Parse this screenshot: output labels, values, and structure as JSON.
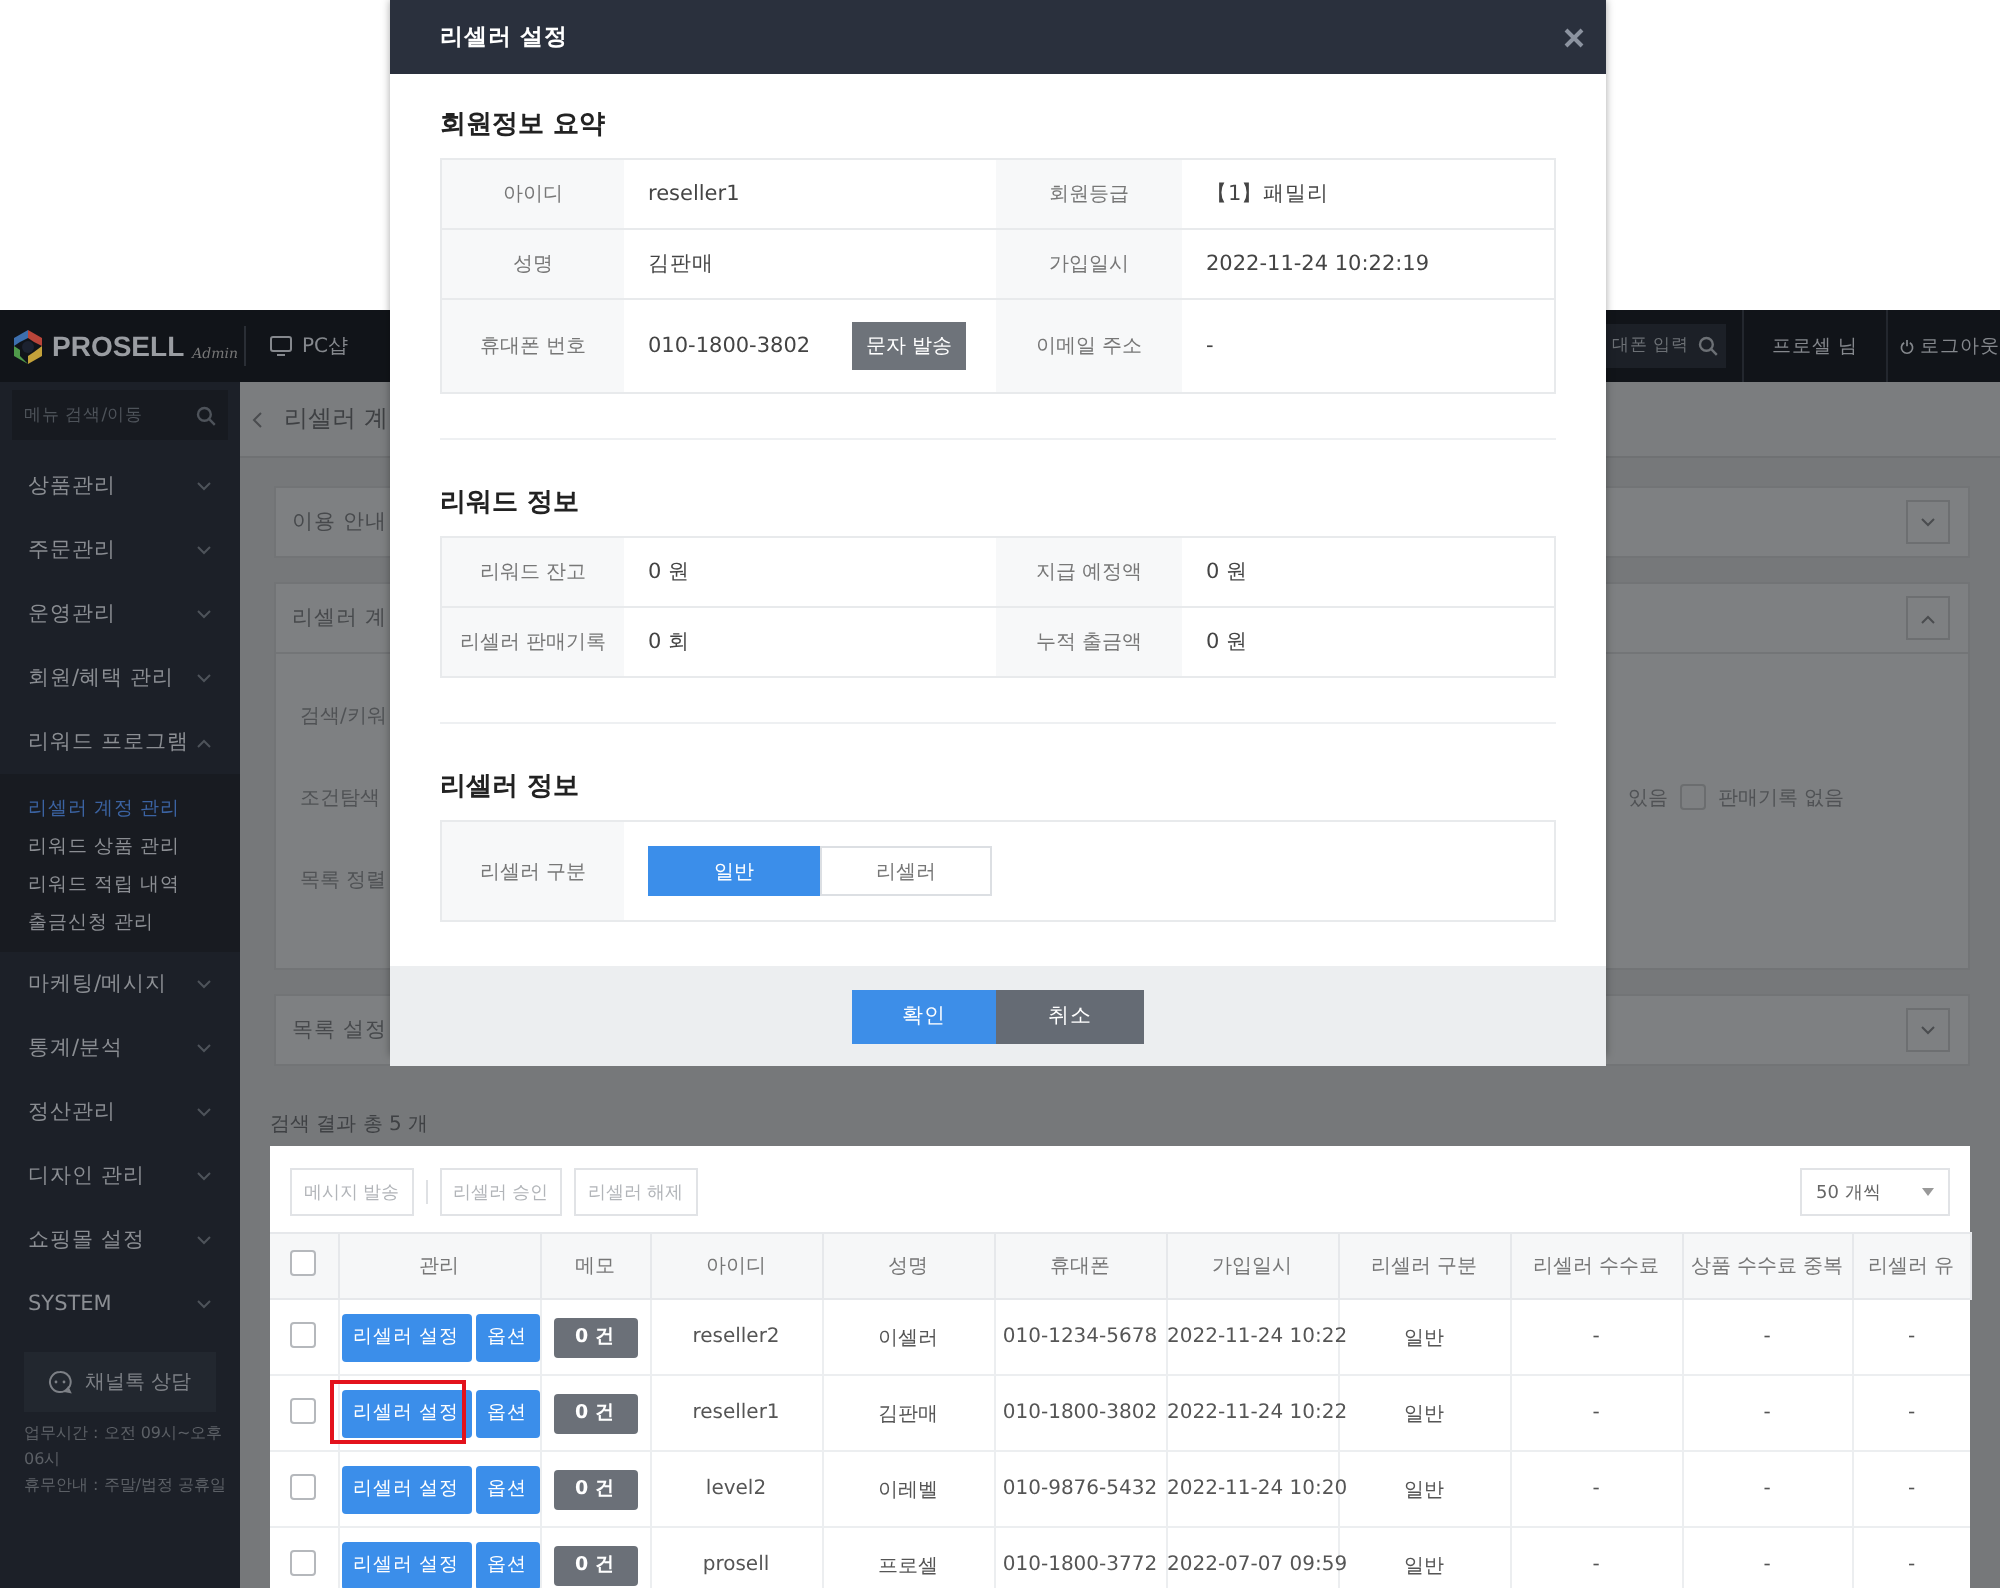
{
  "header": {
    "logo": "PROSELL",
    "logo_sub": "Admin",
    "nav": "PC샵",
    "search_placeholder": "대폰 입력",
    "user": "프로셀 님",
    "logout": "로그아웃"
  },
  "sidebar": {
    "search_placeholder": "메뉴 검색/이동",
    "items": [
      {
        "label": "상품관리",
        "expanded": false
      },
      {
        "label": "주문관리",
        "expanded": false
      },
      {
        "label": "운영관리",
        "expanded": false
      },
      {
        "label": "회원/혜택 관리",
        "expanded": false
      },
      {
        "label": "리워드 프로그램",
        "expanded": true,
        "children": [
          {
            "label": "리셀러 계정 관리",
            "selected": true
          },
          {
            "label": "리워드 상품 관리",
            "selected": false
          },
          {
            "label": "리워드 적립 내역",
            "selected": false
          },
          {
            "label": "출금신청 관리",
            "selected": false
          }
        ]
      },
      {
        "label": "마케팅/메시지",
        "expanded": false
      },
      {
        "label": "통계/분석",
        "expanded": false
      },
      {
        "label": "정산관리",
        "expanded": false
      },
      {
        "label": "디자인 관리",
        "expanded": false
      },
      {
        "label": "쇼핑몰 설정",
        "expanded": false
      },
      {
        "label": "SYSTEM",
        "expanded": false
      }
    ],
    "chat_button": "채널톡 상담",
    "info": [
      "업무시간 : 오전 09시~오후 06시",
      "휴무안내 : 주말/법정 공휴일"
    ]
  },
  "page": {
    "title": "리셀러 계",
    "panels": [
      {
        "title": "이용 안내",
        "expanded": false
      },
      {
        "title": "리셀러 계",
        "expanded": true,
        "rows": [
          {
            "label": "검색/키워"
          },
          {
            "label": "조건탐색",
            "options": [
              {
                "label": "있음"
              },
              {
                "label": "판매기록 없음",
                "checked": false
              }
            ]
          },
          {
            "label": "목록 정렬"
          }
        ]
      },
      {
        "title": "목록 설정",
        "expanded": false
      }
    ],
    "results": "검색 결과 총 5 개",
    "toolbar": [
      {
        "label": "메시지 발송",
        "disabled": true
      },
      {
        "label": "리셀러 승인",
        "disabled": true
      },
      {
        "label": "리셀러 해제",
        "disabled": true
      }
    ],
    "page_size": "50 개씩",
    "table": {
      "select_all": false,
      "columns": [
        "관리",
        "메모",
        "아이디",
        "성명",
        "휴대폰",
        "가입일시",
        "리셀러 구분",
        "리셀러 수수료",
        "상품 수수료 중복",
        "리셀러 유"
      ],
      "rows": [
        {
          "checked": false,
          "cells": [
            {
              "kind": "actions",
              "buttons": [
                "리셀러 설정",
                "옵션"
              ],
              "outlined": false
            },
            {
              "kind": "badge",
              "text": "0 건"
            },
            {
              "kind": "text",
              "text": "reseller2"
            },
            {
              "kind": "text",
              "text": "이셀러"
            },
            {
              "kind": "text",
              "text": "010-1234-5678"
            },
            {
              "kind": "text",
              "text": "2022-11-24 10:22"
            },
            {
              "kind": "text",
              "text": "일반"
            },
            {
              "kind": "text",
              "text": "-"
            },
            {
              "kind": "text",
              "text": "-"
            },
            {
              "kind": "text",
              "text": "-"
            }
          ]
        },
        {
          "checked": false,
          "cells": [
            {
              "kind": "actions",
              "buttons": [
                "리셀러 설정",
                "옵션"
              ],
              "outlined": true
            },
            {
              "kind": "badge",
              "text": "0 건"
            },
            {
              "kind": "text",
              "text": "reseller1"
            },
            {
              "kind": "text",
              "text": "김판매"
            },
            {
              "kind": "text",
              "text": "010-1800-3802"
            },
            {
              "kind": "text",
              "text": "2022-11-24 10:22"
            },
            {
              "kind": "text",
              "text": "일반"
            },
            {
              "kind": "text",
              "text": "-"
            },
            {
              "kind": "text",
              "text": "-"
            },
            {
              "kind": "text",
              "text": "-"
            }
          ]
        },
        {
          "checked": false,
          "cells": [
            {
              "kind": "actions",
              "buttons": [
                "리셀러 설정",
                "옵션"
              ],
              "outlined": false
            },
            {
              "kind": "badge",
              "text": "0 건"
            },
            {
              "kind": "text",
              "text": "level2"
            },
            {
              "kind": "text",
              "text": "이레벨"
            },
            {
              "kind": "text",
              "text": "010-9876-5432"
            },
            {
              "kind": "text",
              "text": "2022-11-24 10:20"
            },
            {
              "kind": "text",
              "text": "일반"
            },
            {
              "kind": "text",
              "text": "-"
            },
            {
              "kind": "text",
              "text": "-"
            },
            {
              "kind": "text",
              "text": "-"
            }
          ]
        },
        {
          "checked": false,
          "cells": [
            {
              "kind": "actions",
              "buttons": [
                "리셀러 설정",
                "옵션"
              ],
              "outlined": false
            },
            {
              "kind": "badge",
              "text": "0 건"
            },
            {
              "kind": "text",
              "text": "prosell"
            },
            {
              "kind": "text",
              "text": "프로셀"
            },
            {
              "kind": "text",
              "text": "010-1800-3772"
            },
            {
              "kind": "text",
              "text": "2022-07-07 09:59"
            },
            {
              "kind": "text",
              "text": "일반"
            },
            {
              "kind": "text",
              "text": "-"
            },
            {
              "kind": "text",
              "text": "-"
            },
            {
              "kind": "text",
              "text": "-"
            }
          ]
        }
      ]
    }
  },
  "modal": {
    "title": "리셀러 설정",
    "sections": [
      {
        "kind": "info",
        "title": "회원정보 요약",
        "rows": [
          [
            {
              "label": "아이디",
              "value": "reseller1"
            },
            {
              "label": "회원등급",
              "value": "【1】패밀리"
            }
          ],
          [
            {
              "label": "성명",
              "value": "김판매"
            },
            {
              "label": "가입일시",
              "value": "2022-11-24 10:22:19"
            }
          ],
          [
            {
              "label": "휴대폰 번호",
              "value": "010-1800-3802",
              "button": "문자 발송"
            },
            {
              "label": "이메일 주소",
              "value": "-"
            }
          ]
        ]
      },
      {
        "kind": "info",
        "title": "리워드 정보",
        "rows": [
          [
            {
              "label": "리워드 잔고",
              "value": "0 원"
            },
            {
              "label": "지급 예정액",
              "value": "0 원"
            }
          ],
          [
            {
              "label": "리셀러 판매기록",
              "value": "0 회"
            },
            {
              "label": "누적 출금액",
              "value": "0 원"
            }
          ]
        ]
      },
      {
        "kind": "choice",
        "title": "리셀러 정보",
        "label": "리셀러 구분",
        "options": [
          {
            "label": "일반",
            "selected": true
          },
          {
            "label": "리셀러",
            "selected": false
          }
        ]
      }
    ],
    "buttons": [
      {
        "label": "확인",
        "kind": "primary"
      },
      {
        "label": "취소",
        "kind": "secondary"
      }
    ]
  }
}
